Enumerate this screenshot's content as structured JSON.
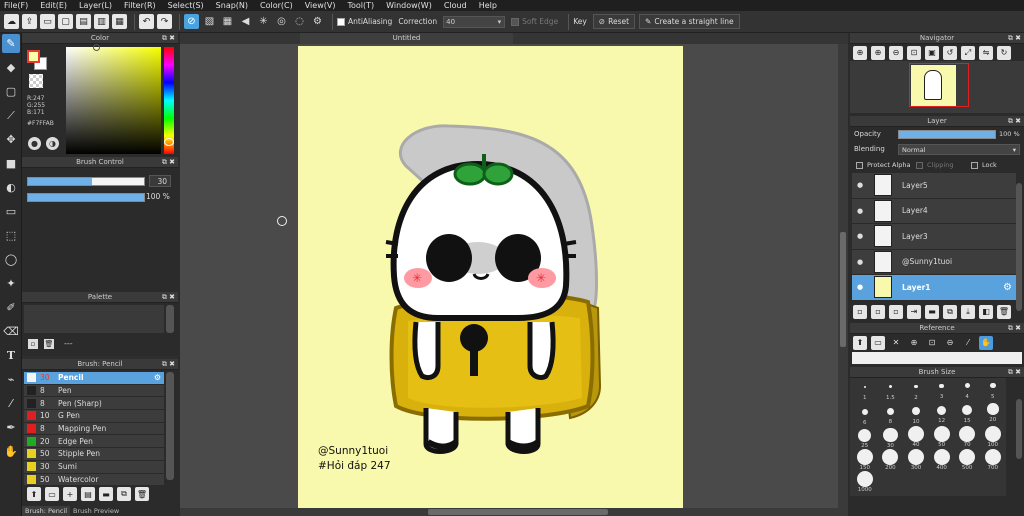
{
  "menu": [
    "File(F)",
    "Edit(E)",
    "Layer(L)",
    "Filter(R)",
    "Select(S)",
    "Snap(N)",
    "Color(C)",
    "View(V)",
    "Tool(T)",
    "Window(W)",
    "Cloud",
    "Help"
  ],
  "toolbar": {
    "antialiasing_label": "AntiAliasing",
    "correction_label": "Correction",
    "correction_value": "40",
    "soft_edge_label": "Soft Edge",
    "key_label": "Key",
    "reset_label": "Reset",
    "straight_line_label": "Create a straight line"
  },
  "document": {
    "title": "Untitled"
  },
  "color_panel": {
    "title": "Color",
    "r": "R:247",
    "g": "G:255",
    "b": "B:171",
    "hex": "#F7FFAB",
    "foreground_color": "#F7FFAB",
    "background_color": "#ffffff",
    "accent": "#e63b2e"
  },
  "brush_control": {
    "title": "Brush Control",
    "size_value": "30",
    "size_fraction": 0.55,
    "opacity_value": "100 %",
    "opacity_fraction": 1.0
  },
  "palette": {
    "title": "Palette",
    "footer_text": "---"
  },
  "brush_list": {
    "title": "Brush: Pencil",
    "items": [
      {
        "size": "30",
        "name": "Pencil",
        "color": "#f4f4f4",
        "selected": true
      },
      {
        "size": "8",
        "name": "Pen",
        "color": "#222222"
      },
      {
        "size": "8",
        "name": "Pen (Sharp)",
        "color": "#222222"
      },
      {
        "size": "10",
        "name": "G Pen",
        "color": "#e02020"
      },
      {
        "size": "8",
        "name": "Mapping Pen",
        "color": "#e02020"
      },
      {
        "size": "20",
        "name": "Edge Pen",
        "color": "#22aa22"
      },
      {
        "size": "50",
        "name": "Stipple Pen",
        "color": "#e8d020"
      },
      {
        "size": "30",
        "name": "Sumi",
        "color": "#e8d020"
      },
      {
        "size": "50",
        "name": "Watercolor",
        "color": "#e8d020"
      }
    ],
    "bottom_tabs": [
      "Brush: Pencil",
      "Brush Preview"
    ]
  },
  "canvas": {
    "paper_color": "#f8f9ac",
    "credit_line1": "@Sunny1tuoi",
    "credit_line2": "#Hỏi đáp 247"
  },
  "navigator": {
    "title": "Navigator"
  },
  "layer_panel": {
    "title": "Layer",
    "opacity_label": "Opacity",
    "opacity_value": "100 %",
    "blending_label": "Blending",
    "blending_value": "Normal",
    "protect_alpha_label": "Protect Alpha",
    "clipping_label": "Clipping",
    "lock_label": "Lock",
    "layers": [
      {
        "name": "Layer5",
        "selected": false
      },
      {
        "name": "Layer4",
        "selected": false
      },
      {
        "name": "Layer3",
        "selected": false
      },
      {
        "name": "@Sunny1tuoi",
        "selected": false
      },
      {
        "name": "Layer1",
        "selected": true
      }
    ]
  },
  "reference": {
    "title": "Reference"
  },
  "brush_size": {
    "title": "Brush Size",
    "sizes": [
      "1",
      "1.5",
      "2",
      "3",
      "4",
      "5",
      "6",
      "8",
      "10",
      "12",
      "15",
      "20",
      "25",
      "30",
      "40",
      "50",
      "70",
      "100",
      "150",
      "200",
      "300",
      "400",
      "500",
      "700",
      "1000"
    ]
  }
}
